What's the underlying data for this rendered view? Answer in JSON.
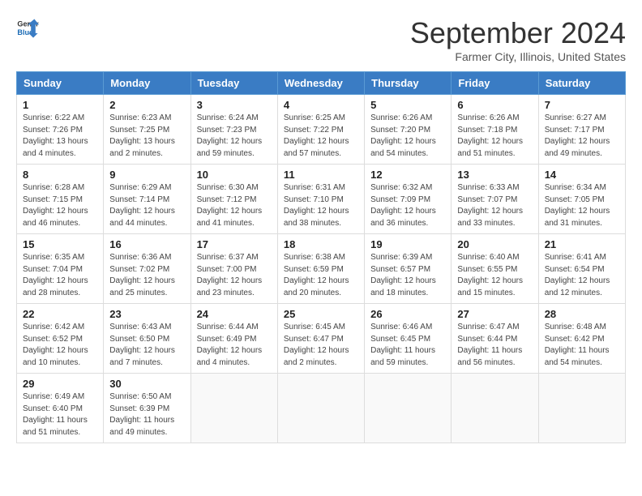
{
  "header": {
    "logo_line1": "General",
    "logo_line2": "Blue",
    "month": "September 2024",
    "location": "Farmer City, Illinois, United States"
  },
  "weekdays": [
    "Sunday",
    "Monday",
    "Tuesday",
    "Wednesday",
    "Thursday",
    "Friday",
    "Saturday"
  ],
  "weeks": [
    [
      {
        "day": 1,
        "info": "Sunrise: 6:22 AM\nSunset: 7:26 PM\nDaylight: 13 hours\nand 4 minutes."
      },
      {
        "day": 2,
        "info": "Sunrise: 6:23 AM\nSunset: 7:25 PM\nDaylight: 13 hours\nand 2 minutes."
      },
      {
        "day": 3,
        "info": "Sunrise: 6:24 AM\nSunset: 7:23 PM\nDaylight: 12 hours\nand 59 minutes."
      },
      {
        "day": 4,
        "info": "Sunrise: 6:25 AM\nSunset: 7:22 PM\nDaylight: 12 hours\nand 57 minutes."
      },
      {
        "day": 5,
        "info": "Sunrise: 6:26 AM\nSunset: 7:20 PM\nDaylight: 12 hours\nand 54 minutes."
      },
      {
        "day": 6,
        "info": "Sunrise: 6:26 AM\nSunset: 7:18 PM\nDaylight: 12 hours\nand 51 minutes."
      },
      {
        "day": 7,
        "info": "Sunrise: 6:27 AM\nSunset: 7:17 PM\nDaylight: 12 hours\nand 49 minutes."
      }
    ],
    [
      {
        "day": 8,
        "info": "Sunrise: 6:28 AM\nSunset: 7:15 PM\nDaylight: 12 hours\nand 46 minutes."
      },
      {
        "day": 9,
        "info": "Sunrise: 6:29 AM\nSunset: 7:14 PM\nDaylight: 12 hours\nand 44 minutes."
      },
      {
        "day": 10,
        "info": "Sunrise: 6:30 AM\nSunset: 7:12 PM\nDaylight: 12 hours\nand 41 minutes."
      },
      {
        "day": 11,
        "info": "Sunrise: 6:31 AM\nSunset: 7:10 PM\nDaylight: 12 hours\nand 38 minutes."
      },
      {
        "day": 12,
        "info": "Sunrise: 6:32 AM\nSunset: 7:09 PM\nDaylight: 12 hours\nand 36 minutes."
      },
      {
        "day": 13,
        "info": "Sunrise: 6:33 AM\nSunset: 7:07 PM\nDaylight: 12 hours\nand 33 minutes."
      },
      {
        "day": 14,
        "info": "Sunrise: 6:34 AM\nSunset: 7:05 PM\nDaylight: 12 hours\nand 31 minutes."
      }
    ],
    [
      {
        "day": 15,
        "info": "Sunrise: 6:35 AM\nSunset: 7:04 PM\nDaylight: 12 hours\nand 28 minutes."
      },
      {
        "day": 16,
        "info": "Sunrise: 6:36 AM\nSunset: 7:02 PM\nDaylight: 12 hours\nand 25 minutes."
      },
      {
        "day": 17,
        "info": "Sunrise: 6:37 AM\nSunset: 7:00 PM\nDaylight: 12 hours\nand 23 minutes."
      },
      {
        "day": 18,
        "info": "Sunrise: 6:38 AM\nSunset: 6:59 PM\nDaylight: 12 hours\nand 20 minutes."
      },
      {
        "day": 19,
        "info": "Sunrise: 6:39 AM\nSunset: 6:57 PM\nDaylight: 12 hours\nand 18 minutes."
      },
      {
        "day": 20,
        "info": "Sunrise: 6:40 AM\nSunset: 6:55 PM\nDaylight: 12 hours\nand 15 minutes."
      },
      {
        "day": 21,
        "info": "Sunrise: 6:41 AM\nSunset: 6:54 PM\nDaylight: 12 hours\nand 12 minutes."
      }
    ],
    [
      {
        "day": 22,
        "info": "Sunrise: 6:42 AM\nSunset: 6:52 PM\nDaylight: 12 hours\nand 10 minutes."
      },
      {
        "day": 23,
        "info": "Sunrise: 6:43 AM\nSunset: 6:50 PM\nDaylight: 12 hours\nand 7 minutes."
      },
      {
        "day": 24,
        "info": "Sunrise: 6:44 AM\nSunset: 6:49 PM\nDaylight: 12 hours\nand 4 minutes."
      },
      {
        "day": 25,
        "info": "Sunrise: 6:45 AM\nSunset: 6:47 PM\nDaylight: 12 hours\nand 2 minutes."
      },
      {
        "day": 26,
        "info": "Sunrise: 6:46 AM\nSunset: 6:45 PM\nDaylight: 11 hours\nand 59 minutes."
      },
      {
        "day": 27,
        "info": "Sunrise: 6:47 AM\nSunset: 6:44 PM\nDaylight: 11 hours\nand 56 minutes."
      },
      {
        "day": 28,
        "info": "Sunrise: 6:48 AM\nSunset: 6:42 PM\nDaylight: 11 hours\nand 54 minutes."
      }
    ],
    [
      {
        "day": 29,
        "info": "Sunrise: 6:49 AM\nSunset: 6:40 PM\nDaylight: 11 hours\nand 51 minutes."
      },
      {
        "day": 30,
        "info": "Sunrise: 6:50 AM\nSunset: 6:39 PM\nDaylight: 11 hours\nand 49 minutes."
      },
      null,
      null,
      null,
      null,
      null
    ]
  ]
}
